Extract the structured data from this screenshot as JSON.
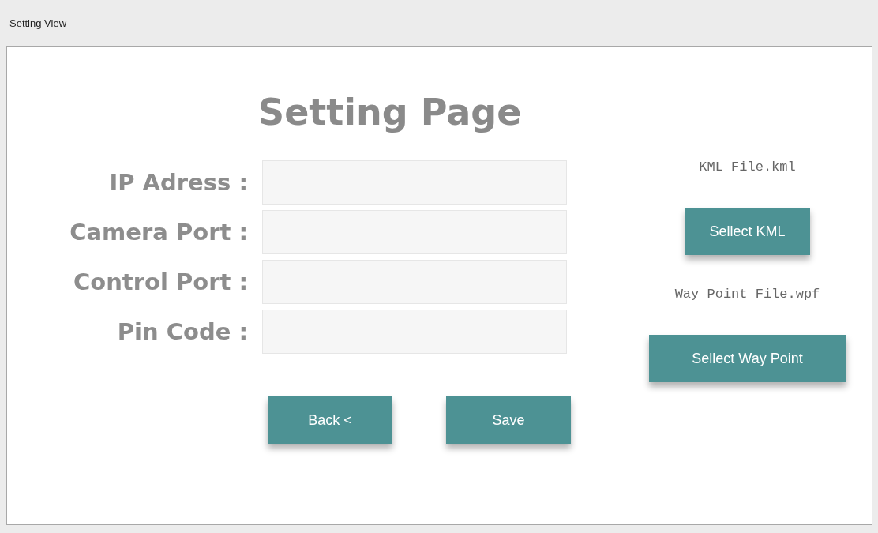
{
  "window": {
    "title": "Setting View"
  },
  "heading": "Setting Page",
  "fields": [
    {
      "label": "IP Adress :"
    },
    {
      "label": "Camera Port :"
    },
    {
      "label": "Control Port :"
    },
    {
      "label": "Pin Code :"
    }
  ],
  "buttons": [
    "Back <",
    "Save"
  ],
  "files": [
    {
      "name": "KML File.kml",
      "button": "Sellect KML"
    },
    {
      "name": "Way Point File.wpf",
      "button": "Sellect Way Point"
    }
  ]
}
